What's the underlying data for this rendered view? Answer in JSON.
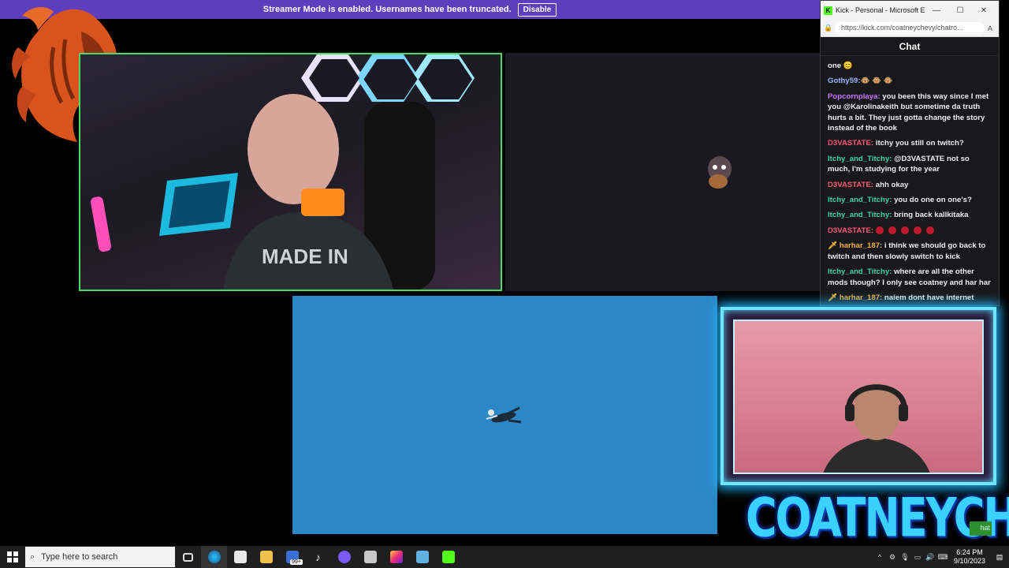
{
  "banner": {
    "text": "Streamer Mode is enabled. Usernames have been truncated.",
    "button": "Disable"
  },
  "browser": {
    "title": "Kick - Personal - Microsoft Edge",
    "url": "https://kick.com/coatneychevy/chatro...",
    "favicon": "K",
    "minimize": "—",
    "maximize": "☐",
    "close": "✕"
  },
  "chat": {
    "header": "Chat",
    "messages": [
      {
        "user": "",
        "text": "one 😊",
        "color": "#efeff1"
      },
      {
        "user": "Gothy59:",
        "text": "🐵 🐵 🐵",
        "color": "#9ab3ff"
      },
      {
        "user": "Popcornplaya:",
        "text": " you been this way since I met you @Karolinakeith but sometime da truth hurts a bit. They just gotta change the story instead of the book",
        "color": "#c779ff"
      },
      {
        "user": "D3VASTATE:",
        "text": " itchy you still on twitch?",
        "color": "#ff5a7a"
      },
      {
        "user": "Itchy_and_Titchy:",
        "text": " @D3VASTATE not so much, I'm studying for the year",
        "color": "#3ad4a4"
      },
      {
        "user": "D3VASTATE:",
        "text": " ahh okay",
        "color": "#ff5a7a"
      },
      {
        "user": "Itchy_and_Titchy:",
        "text": " you do one on one's?",
        "color": "#3ad4a4"
      },
      {
        "user": "Itchy_and_Titchy:",
        "text": " bring back kallkitaka",
        "color": "#3ad4a4"
      },
      {
        "user": "D3VASTATE:",
        "text": "",
        "color": "#ff5a7a",
        "emotes": 5
      },
      {
        "user": "🗡 harhar_187:",
        "text": " i think we should go back to twitch and then slowly switch to kick",
        "color": "#f5b13a"
      },
      {
        "user": "Itchy_and_Titchy:",
        "text": " where are all the other mods though? I only see coatney and har har",
        "color": "#3ad4a4"
      },
      {
        "user": "🗡 harhar_187:",
        "text": " naiem dont have internet",
        "color": "#f5b13a"
      }
    ]
  },
  "overlay": {
    "brand": "COATNEYCHEVY",
    "small_chat": "hat"
  },
  "taskbar": {
    "search_placeholder": "Type here to search",
    "time": "6:24 PM",
    "date": "9/10/2023",
    "apps": [
      "task-view-icon",
      "edge-icon",
      "store-icon",
      "file-explorer-icon",
      "media-app-icon",
      "tiktok-icon",
      "discord-icon",
      "notes-icon",
      "instagram-icon",
      "game-icon",
      "kick-icon"
    ],
    "badge": "99+"
  },
  "colors": {
    "banner": "#5d3fbd",
    "cam_border": "#4cd964",
    "game_bg": "#2b87c6",
    "kick_green": "#53fc18"
  }
}
